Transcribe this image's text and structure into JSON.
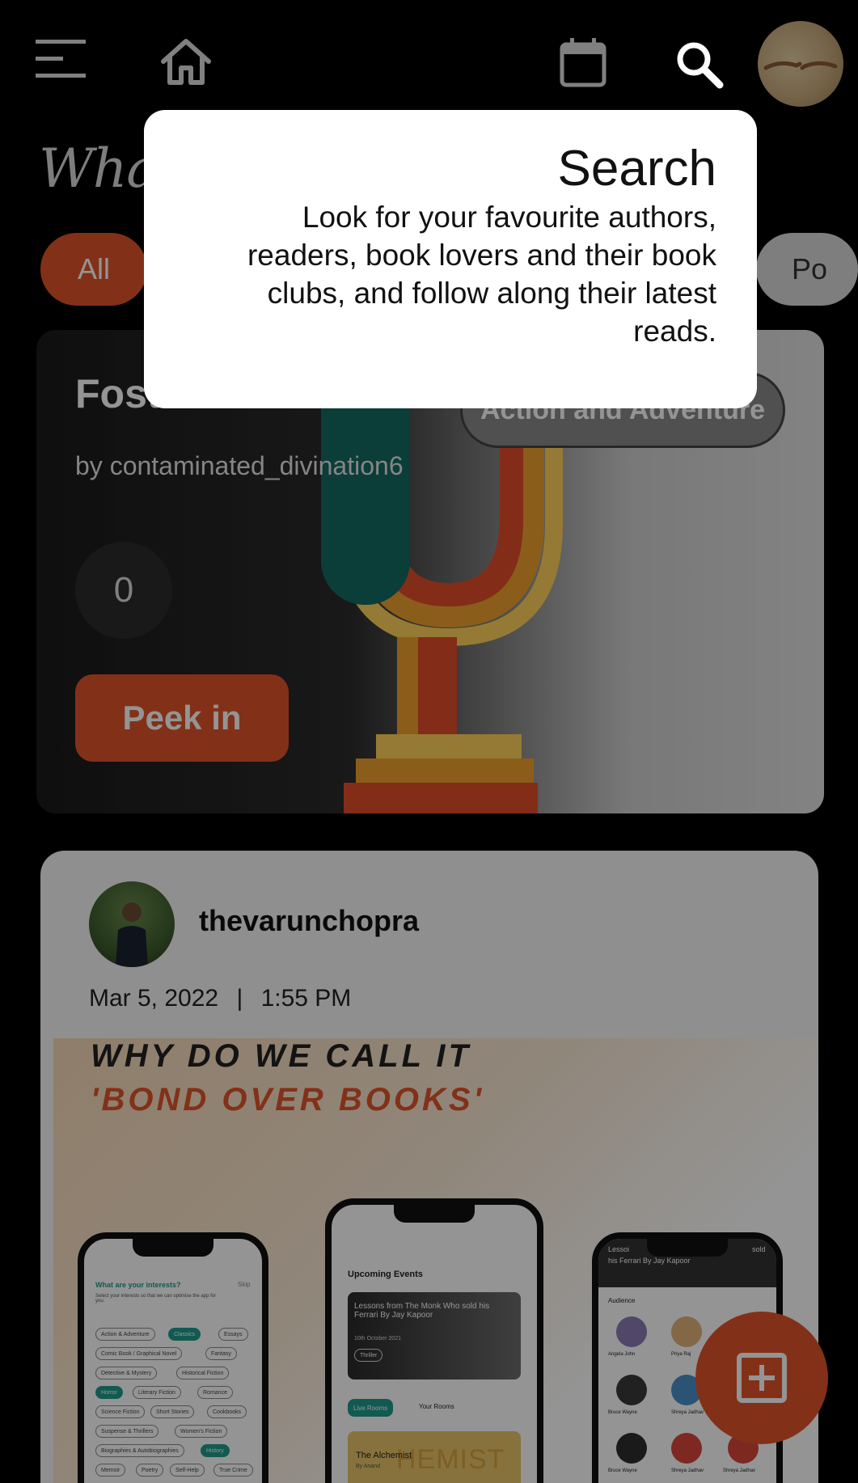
{
  "header": {
    "menu_icon": "hamburger-menu-icon",
    "home_icon": "home-icon",
    "calendar_icon": "calendar-icon",
    "search_icon": "search-icon",
    "profile_icon": "profile-avatar"
  },
  "page": {
    "heading": "What's"
  },
  "filters": {
    "items": [
      "All",
      "Po"
    ],
    "active": "All"
  },
  "room_card": {
    "title": "Foste",
    "author": "by contaminated_divination6",
    "genre": "Action and Adventure",
    "count": "0",
    "peek_label": "Peek in"
  },
  "post": {
    "username": "thevarunchopra",
    "date": "Mar 5, 2022",
    "separator": "|",
    "time": "1:55 PM",
    "promo_line1": "WHY DO WE CALL IT",
    "promo_line2": "'BOND OVER BOOKS'",
    "phone1": {
      "heading": "What are your interests?",
      "skip": "Skip",
      "sub": "Select your interests so that we can optimise the app for you.",
      "pills": [
        "Action & Adventure",
        "Classics",
        "Essays",
        "Comic Book / Graphical Novel",
        "Fantasy",
        "Detective & Mystery",
        "Historical Fiction",
        "Horror",
        "Literary Fiction",
        "Romance",
        "Science Fiction",
        "Short Stories",
        "Cookbooks",
        "Suspense & Thrillers",
        "Women's Fiction",
        "Biographies & Autobiographies",
        "History",
        "Memoir",
        "Poetry",
        "Self-Help",
        "True Crime"
      ]
    },
    "phone2": {
      "heading": "Upcoming Events",
      "event_title": "Lessons from The Monk Who sold his Ferrari By Jay Kapoor",
      "event_date": "10th October 2021",
      "event_tag": "Thriller",
      "tab_live": "Live Rooms",
      "tab_yours": "Your Rooms",
      "room_title": "The Alchemist",
      "room_by": "By Anand",
      "room_bg_text": "HEMIST"
    },
    "phone3": {
      "header_a": "Lessoi",
      "header_b": "his Ferrari By Jay Kapoor",
      "header_c": "sold",
      "section": "Audience",
      "names": [
        "Angela John",
        "Priya Raj",
        "Bruce Wayne",
        "Shreya Jadhav",
        "Bruce Wayne",
        "Shreya Jadhav",
        "Shreya Jadhav"
      ]
    }
  },
  "fab": {
    "icon": "add-post-icon"
  },
  "tooltip": {
    "title": "Search",
    "body": "Look for your favourite authors, readers, book lovers and their book clubs, and follow along their latest reads."
  },
  "colors": {
    "accent": "#e0552a",
    "background": "#000000",
    "teal": "#1f9c8c"
  }
}
